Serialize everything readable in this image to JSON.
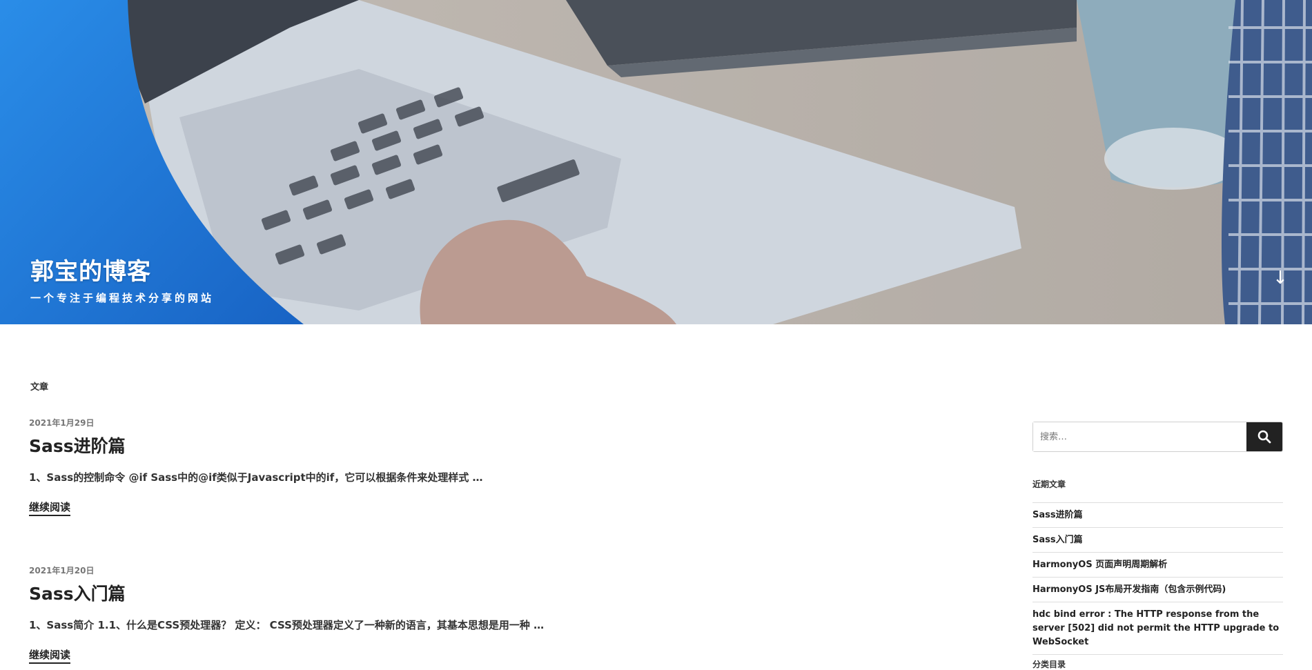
{
  "header": {
    "site_title": "郭宝的博客",
    "site_description": "一个专注于编程技术分享的网站",
    "scroll_icon": "↓"
  },
  "main": {
    "section_label": "文章",
    "posts": [
      {
        "date": "2021年1月29日",
        "title": "Sass进阶篇",
        "excerpt": "1、Sass的控制命令 @if Sass中的@if类似于Javascript中的if，它可以根据条件来处理样式 …",
        "read_more": "继续阅读"
      },
      {
        "date": "2021年1月20日",
        "title": "Sass入门篇",
        "excerpt": "1、Sass简介 1.1、什么是CSS预处理器？ 定义： CSS预处理器定义了一种新的语言，其基本思想是用一种 …",
        "read_more": "继续阅读"
      }
    ]
  },
  "sidebar": {
    "search": {
      "placeholder": "搜索…",
      "button_icon": "search-icon"
    },
    "recent_title": "近期文章",
    "recent_posts": [
      "Sass进阶篇",
      "Sass入门篇",
      "HarmonyOS 页面声明周期解析",
      "HarmonyOS JS布局开发指南（包含示例代码)",
      "hdc bind error : The HTTP response from the server [502] did not permit the HTTP upgrade to WebSocket"
    ],
    "categories_title": "分类目录"
  },
  "colors": {
    "accent_blue": "#1e73d2",
    "button_dark": "#222222",
    "divider": "#dddddd"
  }
}
